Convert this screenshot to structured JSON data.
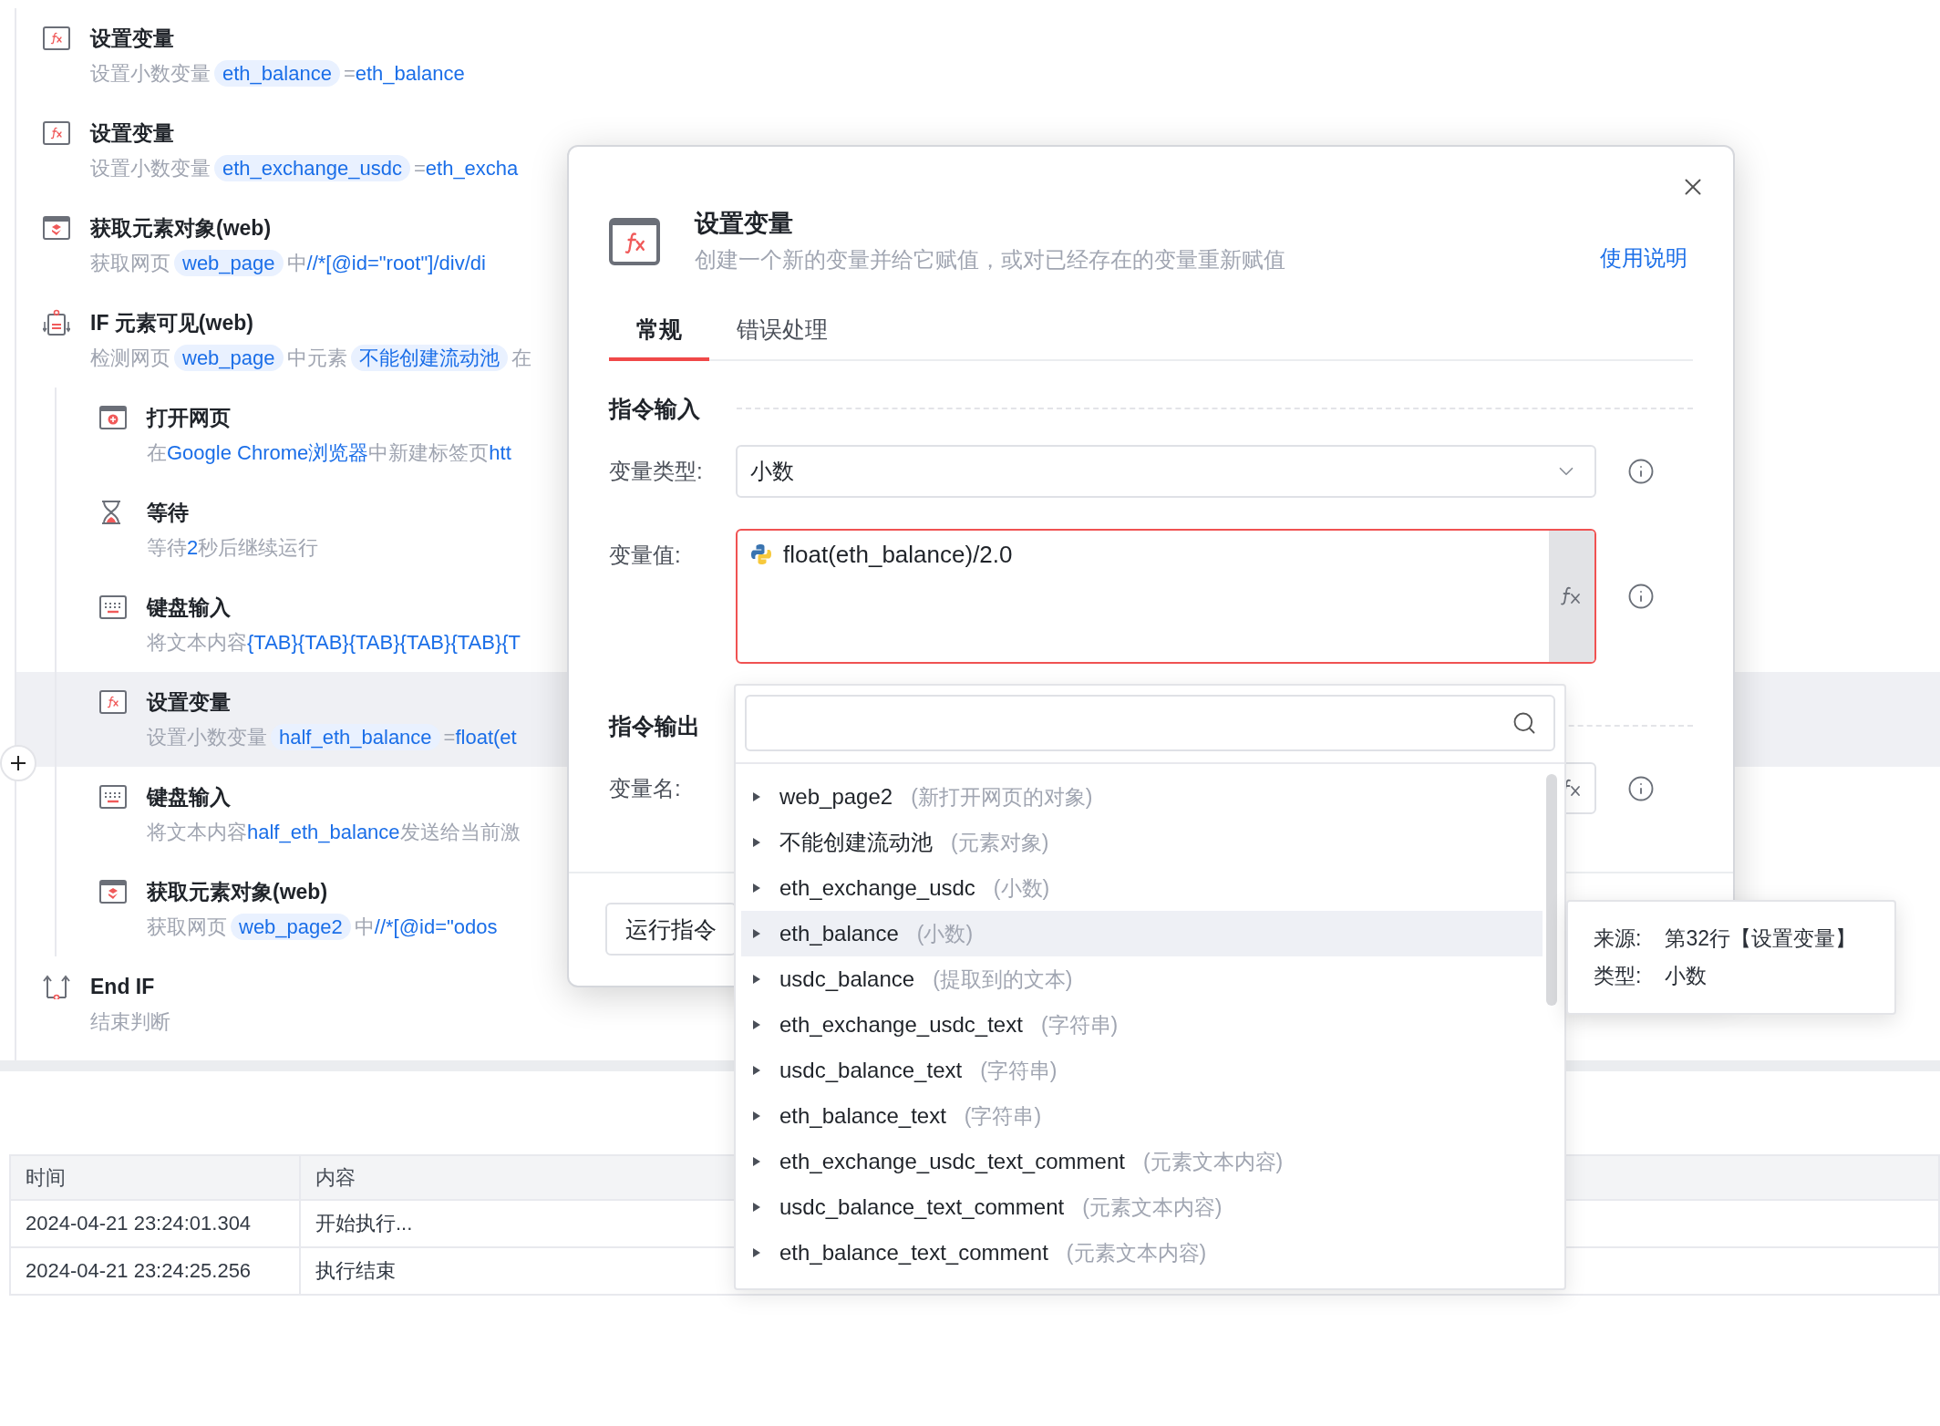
{
  "steps": [
    {
      "kind": "fx",
      "title": "设置变量",
      "selected": false,
      "description": [
        {
          "kind": "muted",
          "text": "设置小数变量"
        },
        {
          "kind": "chip",
          "text": "eth_balance"
        },
        {
          "kind": "muted",
          "text": "="
        },
        {
          "kind": "value",
          "text": "eth_balance"
        }
      ]
    },
    {
      "kind": "fx",
      "title": "设置变量",
      "selected": false,
      "description": [
        {
          "kind": "muted",
          "text": "设置小数变量"
        },
        {
          "kind": "chip",
          "text": "eth_exchange_usdc"
        },
        {
          "kind": "muted",
          "text": "="
        },
        {
          "kind": "value",
          "text": "eth_excha"
        }
      ]
    },
    {
      "kind": "web",
      "title": "获取元素对象(web)",
      "selected": false,
      "description": [
        {
          "kind": "muted",
          "text": "获取网页"
        },
        {
          "kind": "chip",
          "text": "web_page"
        },
        {
          "kind": "muted",
          "text": "中"
        },
        {
          "kind": "value",
          "text": "//*[@id=\"root\"]/div/di"
        }
      ]
    },
    {
      "kind": "if",
      "title": "IF 元素可见(web)",
      "selected": false,
      "description": [
        {
          "kind": "muted",
          "text": "检测网页"
        },
        {
          "kind": "chip",
          "text": "web_page"
        },
        {
          "kind": "muted",
          "text": "中元素"
        },
        {
          "kind": "chip",
          "text": "不能创建流动池"
        },
        {
          "kind": "muted",
          "text": "在"
        }
      ],
      "children": [
        {
          "kind": "open",
          "title": "打开网页",
          "selected": false,
          "description": [
            {
              "kind": "muted",
              "text": "在"
            },
            {
              "kind": "value",
              "text": "Google Chrome浏览器"
            },
            {
              "kind": "muted",
              "text": "中新建标签页"
            },
            {
              "kind": "value",
              "text": "htt"
            }
          ]
        },
        {
          "kind": "wait",
          "title": "等待",
          "selected": false,
          "description": [
            {
              "kind": "muted",
              "text": "等待"
            },
            {
              "kind": "value",
              "text": "2"
            },
            {
              "kind": "muted",
              "text": "秒后继续运行"
            }
          ]
        },
        {
          "kind": "keyboard",
          "title": "键盘输入",
          "selected": false,
          "description": [
            {
              "kind": "muted",
              "text": "将文本内容"
            },
            {
              "kind": "value",
              "text": "{TAB}{TAB}{TAB}{TAB}{TAB}{T"
            }
          ]
        },
        {
          "kind": "fx",
          "title": "设置变量",
          "selected": true,
          "description": [
            {
              "kind": "muted",
              "text": "设置小数变量"
            },
            {
              "kind": "chip",
              "text": "half_eth_balance"
            },
            {
              "kind": "muted",
              "text": "="
            },
            {
              "kind": "value",
              "text": "float(et"
            }
          ]
        },
        {
          "kind": "keyboard",
          "title": "键盘输入",
          "selected": false,
          "description": [
            {
              "kind": "muted",
              "text": "将文本内容"
            },
            {
              "kind": "value",
              "text": "half_eth_balance"
            },
            {
              "kind": "muted",
              "text": "发送给当前激"
            }
          ]
        },
        {
          "kind": "web",
          "title": "获取元素对象(web)",
          "selected": false,
          "description": [
            {
              "kind": "muted",
              "text": "获取网页"
            },
            {
              "kind": "chip",
              "text": "web_page2"
            },
            {
              "kind": "muted",
              "text": "中"
            },
            {
              "kind": "value",
              "text": "//*[@id=\"odos"
            }
          ]
        }
      ]
    },
    {
      "kind": "endif",
      "title": "End IF",
      "selected": false,
      "description": [
        {
          "kind": "muted",
          "text": "结束判断"
        }
      ]
    }
  ],
  "log": {
    "columns": [
      "时间",
      "内容"
    ],
    "rows": [
      [
        "2024-04-21 23:24:01.304",
        "开始执行..."
      ],
      [
        "2024-04-21 23:24:25.256",
        "执行结束"
      ]
    ]
  },
  "dialog": {
    "title": "设置变量",
    "subtitle": "创建一个新的变量并给它赋值，或对已经存在的变量重新赋值",
    "help_link": "使用说明",
    "tabs": [
      {
        "label": "常规",
        "selected": true
      },
      {
        "label": "错误处理",
        "selected": false
      }
    ],
    "sections": [
      {
        "title": "指令输入",
        "fields": [
          {
            "kind": "select",
            "label": "变量类型:",
            "value": "小数"
          },
          {
            "kind": "expression",
            "label": "变量值:",
            "value": "float(eth_balance)/2.0",
            "error": true
          }
        ]
      },
      {
        "title": "指令输出",
        "fields": [
          {
            "kind": "name",
            "label": "变量名:"
          }
        ]
      }
    ],
    "run_button": "运行指令"
  },
  "dropdown": {
    "items": [
      {
        "name": "web_page2",
        "type": "(新打开网页的对象)",
        "expanded": false,
        "highlighted": false
      },
      {
        "name": "不能创建流动池",
        "type": "(元素对象)",
        "expanded": false,
        "highlighted": false
      },
      {
        "name": "eth_exchange_usdc",
        "type": "(小数)",
        "expanded": false,
        "highlighted": false
      },
      {
        "name": "eth_balance",
        "type": "(小数)",
        "expanded": false,
        "highlighted": true
      },
      {
        "name": "usdc_balance",
        "type": "(提取到的文本)",
        "expanded": false,
        "highlighted": false
      },
      {
        "name": "eth_exchange_usdc_text",
        "type": "(字符串)",
        "expanded": false,
        "highlighted": false
      },
      {
        "name": "usdc_balance_text",
        "type": "(字符串)",
        "expanded": false,
        "highlighted": false
      },
      {
        "name": "eth_balance_text",
        "type": "(字符串)",
        "expanded": false,
        "highlighted": false
      },
      {
        "name": "eth_exchange_usdc_text_comment",
        "type": "(元素文本内容)",
        "expanded": false,
        "highlighted": false
      },
      {
        "name": "usdc_balance_text_comment",
        "type": "(元素文本内容)",
        "expanded": false,
        "highlighted": false
      },
      {
        "name": "eth_balance_text_comment",
        "type": "(元素文本内容)",
        "expanded": false,
        "highlighted": false
      }
    ]
  },
  "tooltip": {
    "rows": [
      {
        "label": "来源:",
        "value": "第32行【设置变量】"
      },
      {
        "label": "类型:",
        "value": "小数"
      }
    ]
  }
}
